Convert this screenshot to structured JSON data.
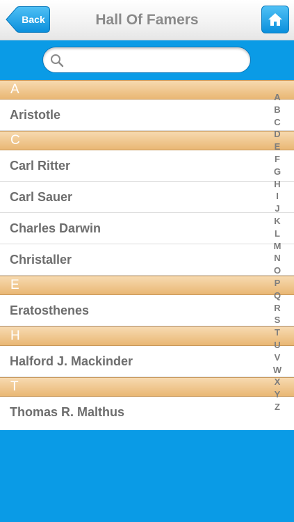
{
  "nav": {
    "back_label": "Back",
    "title": "Hall Of Famers",
    "home_icon": "home-icon"
  },
  "search": {
    "placeholder": "",
    "icon": "search-icon"
  },
  "sections": [
    {
      "letter": "A",
      "items": [
        "Aristotle"
      ]
    },
    {
      "letter": "C",
      "items": [
        "Carl Ritter",
        "Carl Sauer",
        "Charles Darwin",
        "Christaller"
      ]
    },
    {
      "letter": "E",
      "items": [
        "Eratosthenes"
      ]
    },
    {
      "letter": "H",
      "items": [
        "Halford J. Mackinder"
      ]
    },
    {
      "letter": "T",
      "items": [
        "Thomas R. Malthus"
      ]
    }
  ],
  "index": [
    "A",
    "B",
    "C",
    "D",
    "E",
    "F",
    "G",
    "H",
    "I",
    "J",
    "K",
    "L",
    "M",
    "N",
    "O",
    "P",
    "Q",
    "R",
    "S",
    "T",
    "U",
    "V",
    "W",
    "X",
    "Y",
    "Z"
  ],
  "colors": {
    "accent_blue": "#0a9be6",
    "section_header": "#e9b774",
    "row_text": "#6d6d6d",
    "title_text": "#8a8a8a"
  }
}
